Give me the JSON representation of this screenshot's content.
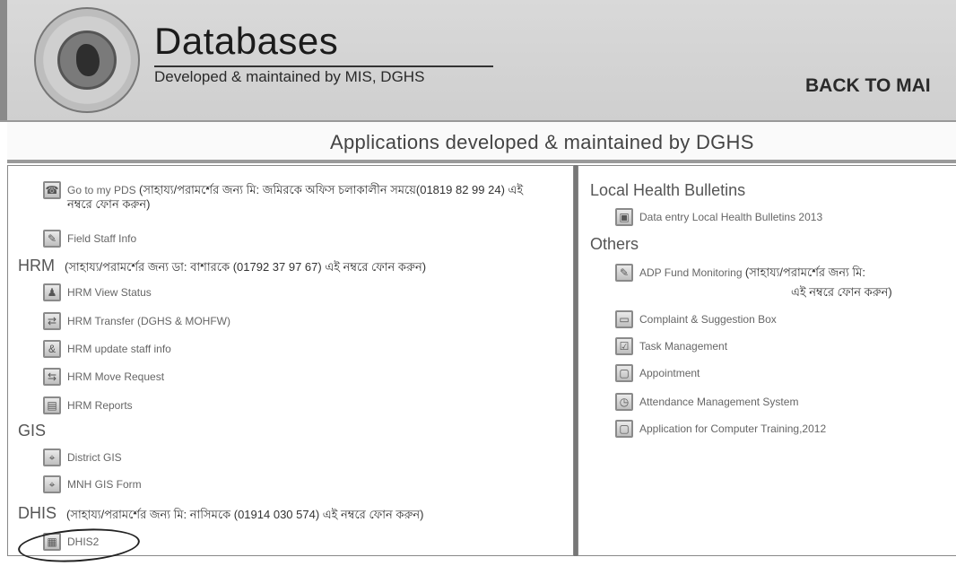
{
  "header": {
    "title": "Databases",
    "subtitle": "Developed & maintained by MIS, DGHS",
    "back_link": "BACK TO MAI"
  },
  "banner": {
    "title": "Applications developed & maintained by DGHS"
  },
  "left": {
    "pds": {
      "label": "Go to my PDS",
      "note": "(সাহায্য/পরামর্শের জন্য মি: জমিরকে অফিস চলাকালীন সময়ে(01819 82 99 24) এই নম্বরে ফোন করুন)",
      "icon": "phone-icon"
    },
    "field_staff": {
      "label": "Field Staff Info",
      "icon": "pencil-icon"
    },
    "hrm": {
      "title": "HRM",
      "note": "(সাহায্য/পরামর্শের জন্য ডা: বাশারকে (01792 37 97 67) এই নম্বরে ফোন করুন)",
      "items": [
        {
          "label": "HRM View Status",
          "icon": "person-icon"
        },
        {
          "label": "HRM Transfer (DGHS & MOHFW)",
          "icon": "transfer-icon"
        },
        {
          "label": "HRM update staff info",
          "icon": "user-edit-icon"
        },
        {
          "label": "HRM Move Request",
          "icon": "move-icon"
        },
        {
          "label": "HRM Reports",
          "icon": "report-icon"
        }
      ]
    },
    "gis": {
      "title": "GIS",
      "items": [
        {
          "label": "District GIS",
          "icon": "map-icon"
        },
        {
          "label": "MNH GIS Form",
          "icon": "map-icon"
        }
      ]
    },
    "dhis": {
      "title": "DHIS",
      "note": "(সাহায্য/পরামর্শের জন্য মি: নাসিমকে (01914 030 574) এই নম্বরে ফোন করুন)",
      "items": [
        {
          "label": "DHIS2",
          "icon": "database-icon"
        }
      ]
    }
  },
  "right": {
    "bulletins": {
      "title": "Local Health Bulletins",
      "items": [
        {
          "label": "Data entry Local Health Bulletins 2013",
          "icon": "document-icon"
        }
      ]
    },
    "others": {
      "title": "Others",
      "adp": {
        "label": "ADP Fund Monitoring",
        "note": "(সাহায্য/পরামর্শের জন্য মি:",
        "note2": "এই নম্বরে ফোন করুন)",
        "icon": "pencil-icon"
      },
      "items": [
        {
          "label": "Complaint & Suggestion Box",
          "icon": "inbox-icon"
        },
        {
          "label": "Task Management",
          "icon": "task-icon"
        },
        {
          "label": "Appointment",
          "icon": "calendar-icon"
        },
        {
          "label": "Attendance Management System",
          "icon": "clock-icon"
        },
        {
          "label": "Application for Computer Training,2012",
          "icon": "computer-icon"
        }
      ]
    }
  }
}
